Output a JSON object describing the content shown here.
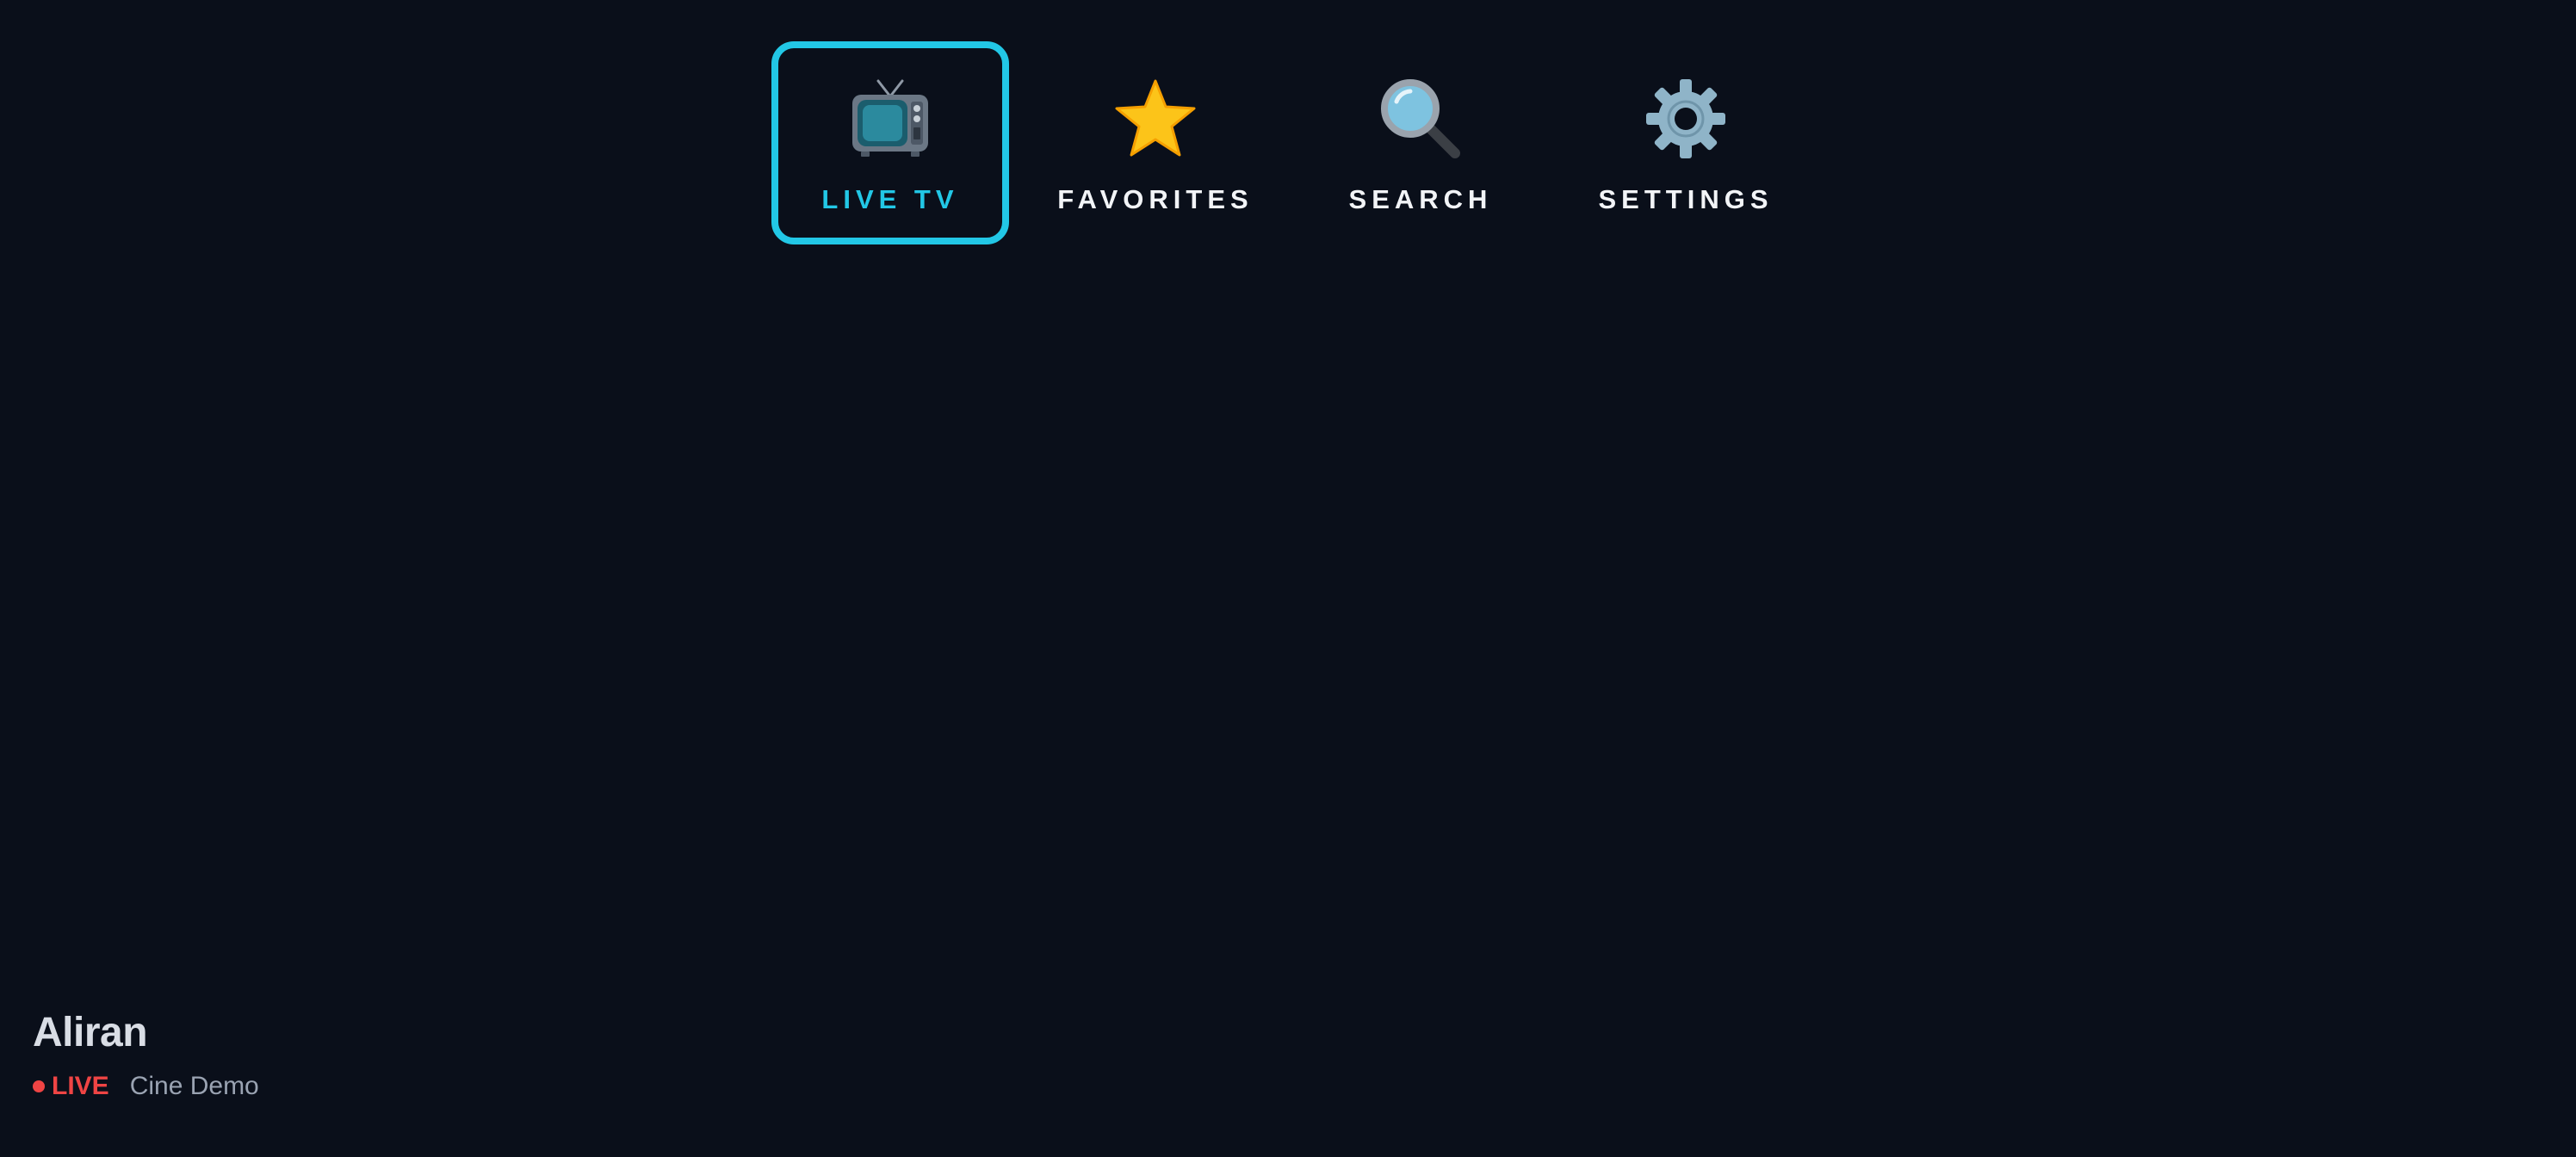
{
  "nav": {
    "items": [
      {
        "label": "LIVE TV",
        "icon": "tv-icon",
        "active": true
      },
      {
        "label": "FAVORITES",
        "icon": "star-icon",
        "active": false
      },
      {
        "label": "SEARCH",
        "icon": "magnifier-icon",
        "active": false
      },
      {
        "label": "SETTINGS",
        "icon": "gear-icon",
        "active": false
      }
    ]
  },
  "now_playing": {
    "channel": "Aliran",
    "live_label": "LIVE",
    "provider": "Cine Demo"
  },
  "colors": {
    "background": "#0a0f1a",
    "accent": "#22c7e6",
    "live": "#ef4444"
  }
}
